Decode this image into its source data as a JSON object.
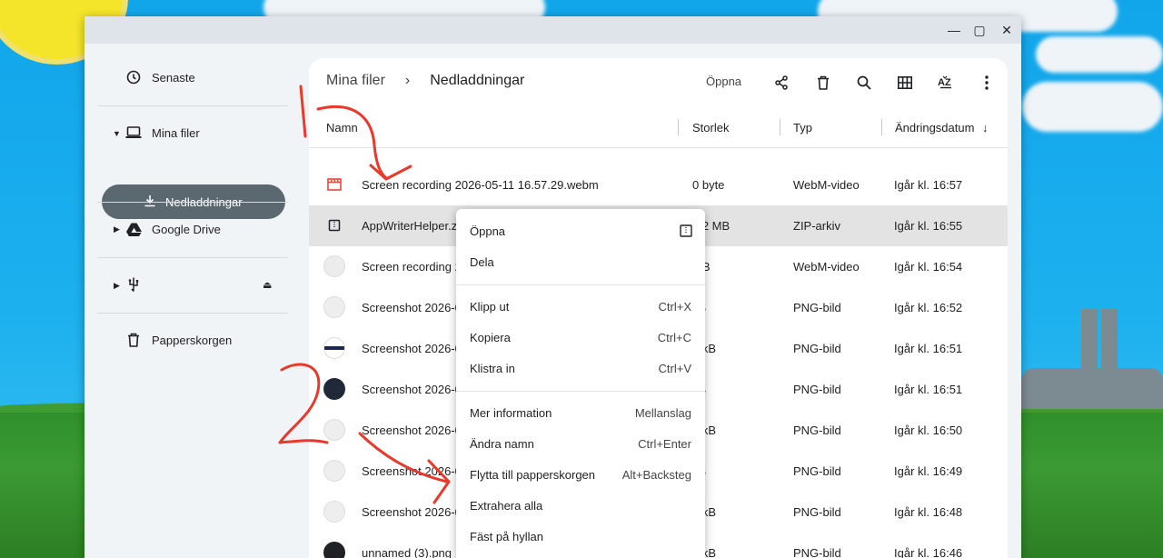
{
  "window": {
    "minimize": "—",
    "maximize": "▢",
    "close": "✕"
  },
  "sidebar": {
    "recent": "Senaste",
    "my_files": "Mina filer",
    "downloads": "Nedladdningar",
    "google_drive": "Google Drive",
    "trash": "Papperskorgen"
  },
  "breadcrumb": {
    "root": "Mina filer",
    "separator": "›",
    "current": "Nedladdningar"
  },
  "toolbar": {
    "open": "Öppna"
  },
  "columns": {
    "name": "Namn",
    "size": "Storlek",
    "type": "Typ",
    "date": "Ändringsdatum",
    "sort_arrow": "↓"
  },
  "files": [
    {
      "name": "Screen recording 2026-05-11 16.57.29.webm",
      "size": "0 byte",
      "type": "WebM-video",
      "date": "Igår kl. 16:57"
    },
    {
      "name": "AppWriterHelper.zip",
      "size": "2,2 MB",
      "type": "ZIP-arkiv",
      "date": "Igår kl. 16:55"
    },
    {
      "name": "Screen recording 2",
      "size": "MB",
      "type": "WebM-video",
      "date": "Igår kl. 16:54"
    },
    {
      "name": "Screenshot 2026-0",
      "size": "kB",
      "type": "PNG-bild",
      "date": "Igår kl. 16:52"
    },
    {
      "name": "Screenshot 2026-0",
      "size": "5 kB",
      "type": "PNG-bild",
      "date": "Igår kl. 16:51"
    },
    {
      "name": "Screenshot 2026-0",
      "size": "kB",
      "type": "PNG-bild",
      "date": "Igår kl. 16:51"
    },
    {
      "name": "Screenshot 2026-0",
      "size": "9 kB",
      "type": "PNG-bild",
      "date": "Igår kl. 16:50"
    },
    {
      "name": "Screenshot 2026-0",
      "size": "kB",
      "type": "PNG-bild",
      "date": "Igår kl. 16:49"
    },
    {
      "name": "Screenshot 2026-0",
      "size": "4 kB",
      "type": "PNG-bild",
      "date": "Igår kl. 16:48"
    },
    {
      "name": "unnamed (3).png",
      "size": "3 kB",
      "type": "PNG-bild",
      "date": "Igår kl. 16:46"
    }
  ],
  "context_menu": [
    {
      "label": "Öppna",
      "shortcut": ""
    },
    {
      "label": "Dela",
      "shortcut": ""
    },
    {
      "label": "Klipp ut",
      "shortcut": "Ctrl+X"
    },
    {
      "label": "Kopiera",
      "shortcut": "Ctrl+C"
    },
    {
      "label": "Klistra in",
      "shortcut": "Ctrl+V"
    },
    {
      "label": "Mer information",
      "shortcut": "Mellanslag"
    },
    {
      "label": "Ändra namn",
      "shortcut": "Ctrl+Enter"
    },
    {
      "label": "Flytta till papperskorgen",
      "shortcut": "Alt+Backsteg"
    },
    {
      "label": "Extrahera alla",
      "shortcut": ""
    },
    {
      "label": "Fäst på hyllan",
      "shortcut": ""
    }
  ],
  "icons": {
    "recent": "clock-icon",
    "my_files": "laptop-icon",
    "downloads": "download-icon",
    "drive": "google-drive-icon",
    "usb": "usb-icon",
    "eject": "eject-icon",
    "trash": "trash-icon",
    "share": "share-icon",
    "delete": "delete-icon",
    "search": "search-icon",
    "grid": "grid-view-icon",
    "sort": "sort-az-icon",
    "more": "more-vert-icon"
  },
  "annotations": {
    "mark1": "1",
    "mark2": "2"
  },
  "colors": {
    "sidebar_active": "#5b6870",
    "selected_row": "#e3e3e3",
    "annotation": "#e8392a"
  }
}
